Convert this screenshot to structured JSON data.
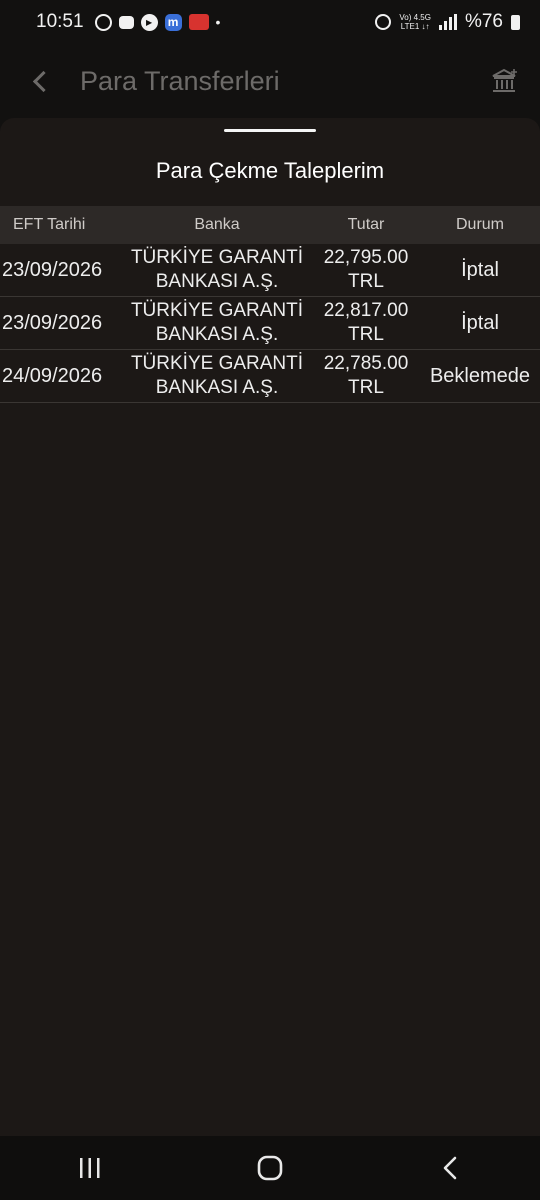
{
  "status_bar": {
    "time": "10:51",
    "network_top": "Vo) 4.5G",
    "network_bottom": "LTE1 ↓↑",
    "battery": "%76"
  },
  "app_bar": {
    "title": "Para Transferleri"
  },
  "sheet": {
    "title": "Para Çekme Taleplerim"
  },
  "table": {
    "columns": [
      "EFT Tarihi",
      "Banka",
      "Tutar",
      "Durum"
    ],
    "rows": [
      {
        "date": "23/09/2026",
        "bank_line1": "TÜRKİYE GARANTİ",
        "bank_line2": "BANKASI A.Ş.",
        "amount_line1": "22,795.00",
        "amount_line2": "TRL",
        "status": "İptal"
      },
      {
        "date": "23/09/2026",
        "bank_line1": "TÜRKİYE GARANTİ",
        "bank_line2": "BANKASI A.Ş.",
        "amount_line1": "22,817.00",
        "amount_line2": "TRL",
        "status": "İptal"
      },
      {
        "date": "24/09/2026",
        "bank_line1": "TÜRKİYE GARANTİ",
        "bank_line2": "BANKASI A.Ş.",
        "amount_line1": "22,785.00",
        "amount_line2": "TRL",
        "status": "Beklemede"
      }
    ]
  },
  "icons": {
    "back": "chevron-left-icon",
    "bank": "bank-icon",
    "nav_recent": "recent-apps-icon",
    "nav_home": "home-icon",
    "nav_back": "nav-back-icon"
  },
  "colors": {
    "background": "#121110",
    "sheet": "#1c1816",
    "header_row": "#2d2927",
    "muted_text": "#6d6b69"
  }
}
